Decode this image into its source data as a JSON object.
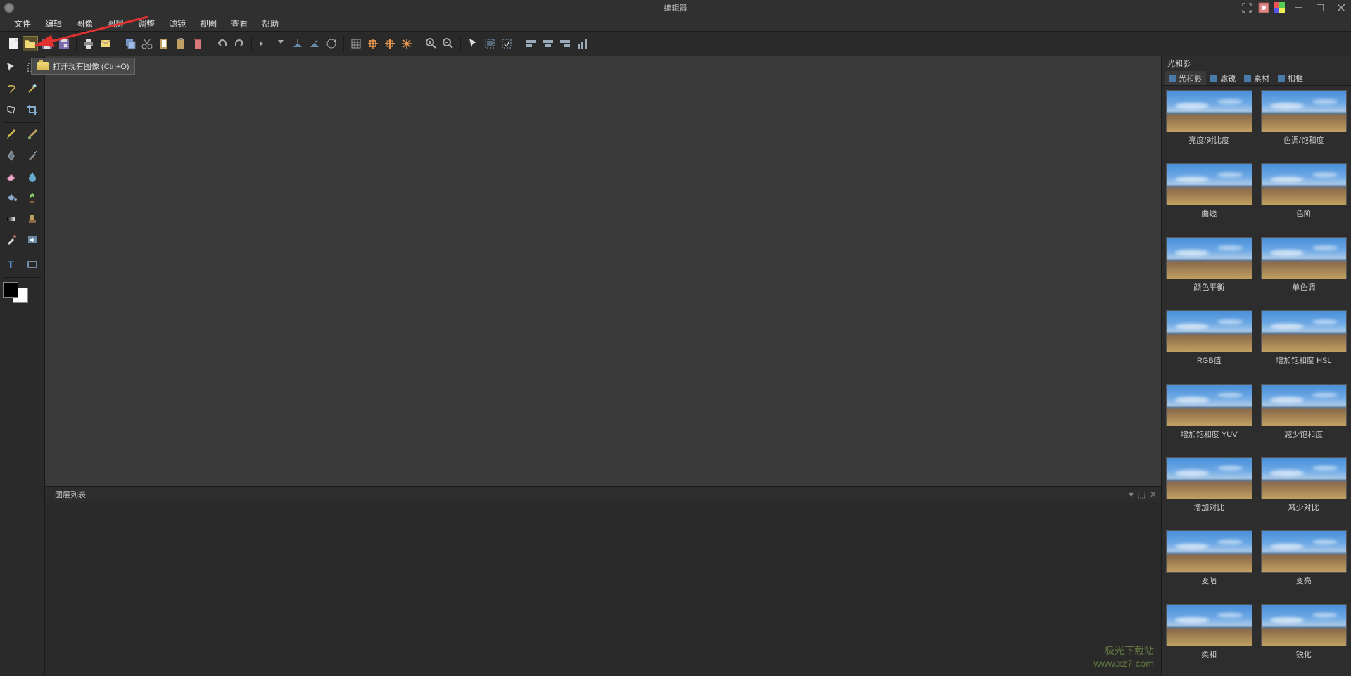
{
  "title": "编辑器",
  "tooltip": "打开现有图像 (Ctrl+O)",
  "menu": [
    "文件",
    "编辑",
    "图像",
    "图层",
    "调整",
    "滤镜",
    "视图",
    "查看",
    "帮助"
  ],
  "rightPanel": {
    "title": "光和影",
    "tabs": [
      "光和影",
      "滤镜",
      "素材",
      "相框"
    ],
    "effects": [
      "亮度/对比度",
      "色调/饱和度",
      "曲线",
      "色阶",
      "颜色平衡",
      "单色调",
      "RGB值",
      "增加饱和度 HSL",
      "增加饱和度 YUV",
      "减少饱和度",
      "增加对比",
      "减少对比",
      "变暗",
      "变亮",
      "柔和",
      "锐化"
    ]
  },
  "bottomPanel": {
    "title": "图层列表"
  },
  "watermark": "极光下载站\nwww.xz7.com"
}
